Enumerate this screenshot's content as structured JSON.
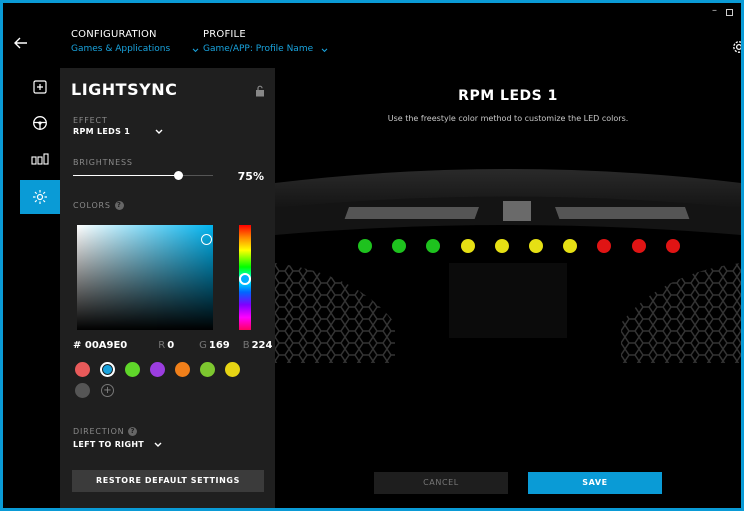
{
  "window": {
    "minimize_glyph": "–"
  },
  "header": {
    "configuration_label": "CONFIGURATION",
    "configuration_value": "Games & Applications",
    "profile_label": "PROFILE",
    "profile_value": "Game/APP: Profile Name"
  },
  "rail": {
    "items": [
      {
        "icon": "plus-square-icon"
      },
      {
        "icon": "steering-wheel-icon"
      },
      {
        "icon": "pedals-icon"
      },
      {
        "icon": "lightsync-icon",
        "active": true
      }
    ]
  },
  "panel": {
    "title": "LIGHTSYNC",
    "effect_label": "EFFECT",
    "effect_value": "RPM LEDS 1",
    "brightness_label": "BRIGHTNESS",
    "brightness_value": "75%",
    "brightness_level": 0.75,
    "colors_label": "COLORS",
    "help_glyph": "?",
    "hex_value": "# 00A9E0",
    "r_label": "R",
    "r_value": "0",
    "g_label": "G",
    "g_value": "169",
    "b_label": "B",
    "b_value": "224",
    "swatches": [
      "#e85a5a",
      "#19a3dd",
      "#5fd62a",
      "#9b3de0",
      "#f07f1a",
      "#7dc72f",
      "#e6d414",
      "#555555"
    ],
    "add_glyph": "+",
    "direction_label": "DIRECTION",
    "direction_value": "LEFT TO RIGHT",
    "restore_label": "RESTORE DEFAULT SETTINGS"
  },
  "main": {
    "title": "RPM LEDS 1",
    "subtitle": "Use the freestyle color method to customize the LED colors.",
    "leds": [
      "#1ec21e",
      "#1ec21e",
      "#1ec21e",
      "#e6e014",
      "#e6e014",
      "#e6e014",
      "#e6e014",
      "#e01414",
      "#e01414",
      "#e01414"
    ],
    "cancel_label": "CANCEL",
    "save_label": "SAVE"
  },
  "accent_color": "#0a9bd6"
}
